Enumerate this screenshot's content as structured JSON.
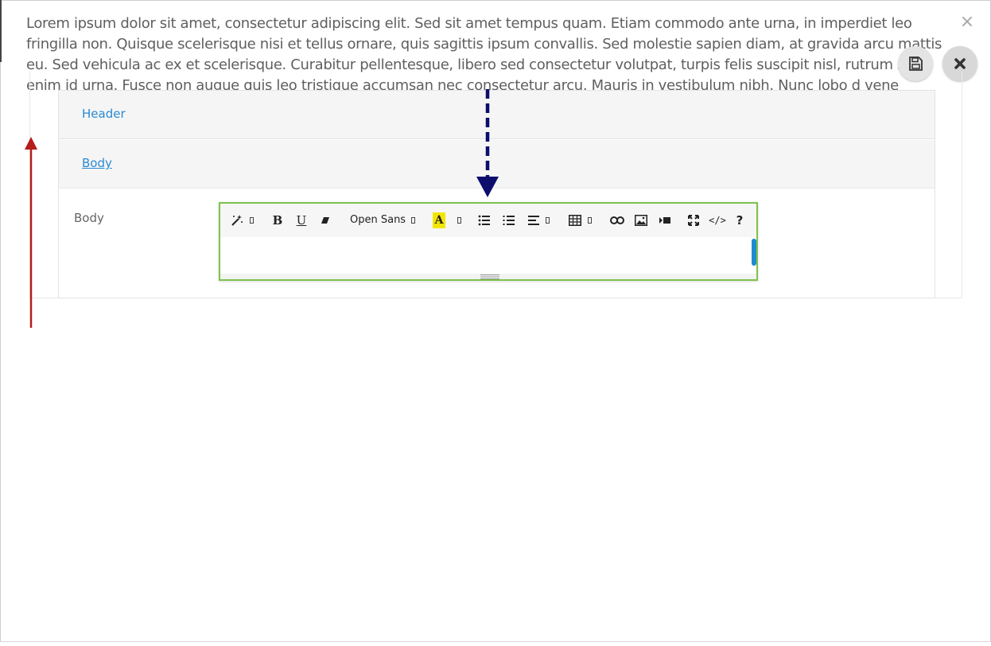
{
  "paragraph": {
    "text": "Lorem ipsum dolor sit amet, consectetur adipiscing elit. Sed sit amet tempus quam. Etiam commodo ante urna, in imperdiet leo fringilla non. Quisque scelerisque nisi et tellus ornare, quis sagittis ipsum convallis. Sed molestie sapien diam, at gravida arcu mattis eu. Sed vehicula ac ex et scelerisque. Curabitur pellentesque, libero sed consectetur volutpat, turpis felis suscipit nisl, rutrum risus enim id urna. Fusce non augue quis leo tristique accumsan nec consectetur arcu. Mauris in vestibulum nibh. Nunc lobo d vene"
  },
  "window": {
    "close_icon": "×"
  },
  "fab": {
    "save_icon": "floppy-disk-icon",
    "close_icon": "x-icon"
  },
  "accordion": {
    "header_label": "Header",
    "body_label": "Body"
  },
  "form": {
    "body_field_label": "Body"
  },
  "editor": {
    "font_name": "Open Sans",
    "bold_glyph": "B",
    "underline_glyph": "U",
    "highlight_glyph": "A",
    "codeview_glyph": "</>",
    "help_glyph": "?"
  },
  "colors": {
    "link": "#2a8ad4",
    "editor_border": "#7dc34b",
    "scroll_thumb": "#1f8ad0",
    "annotation_blue": "#0d0d6e",
    "annotation_red": "#b51c1c",
    "highlight_yellow": "#f2e600"
  }
}
